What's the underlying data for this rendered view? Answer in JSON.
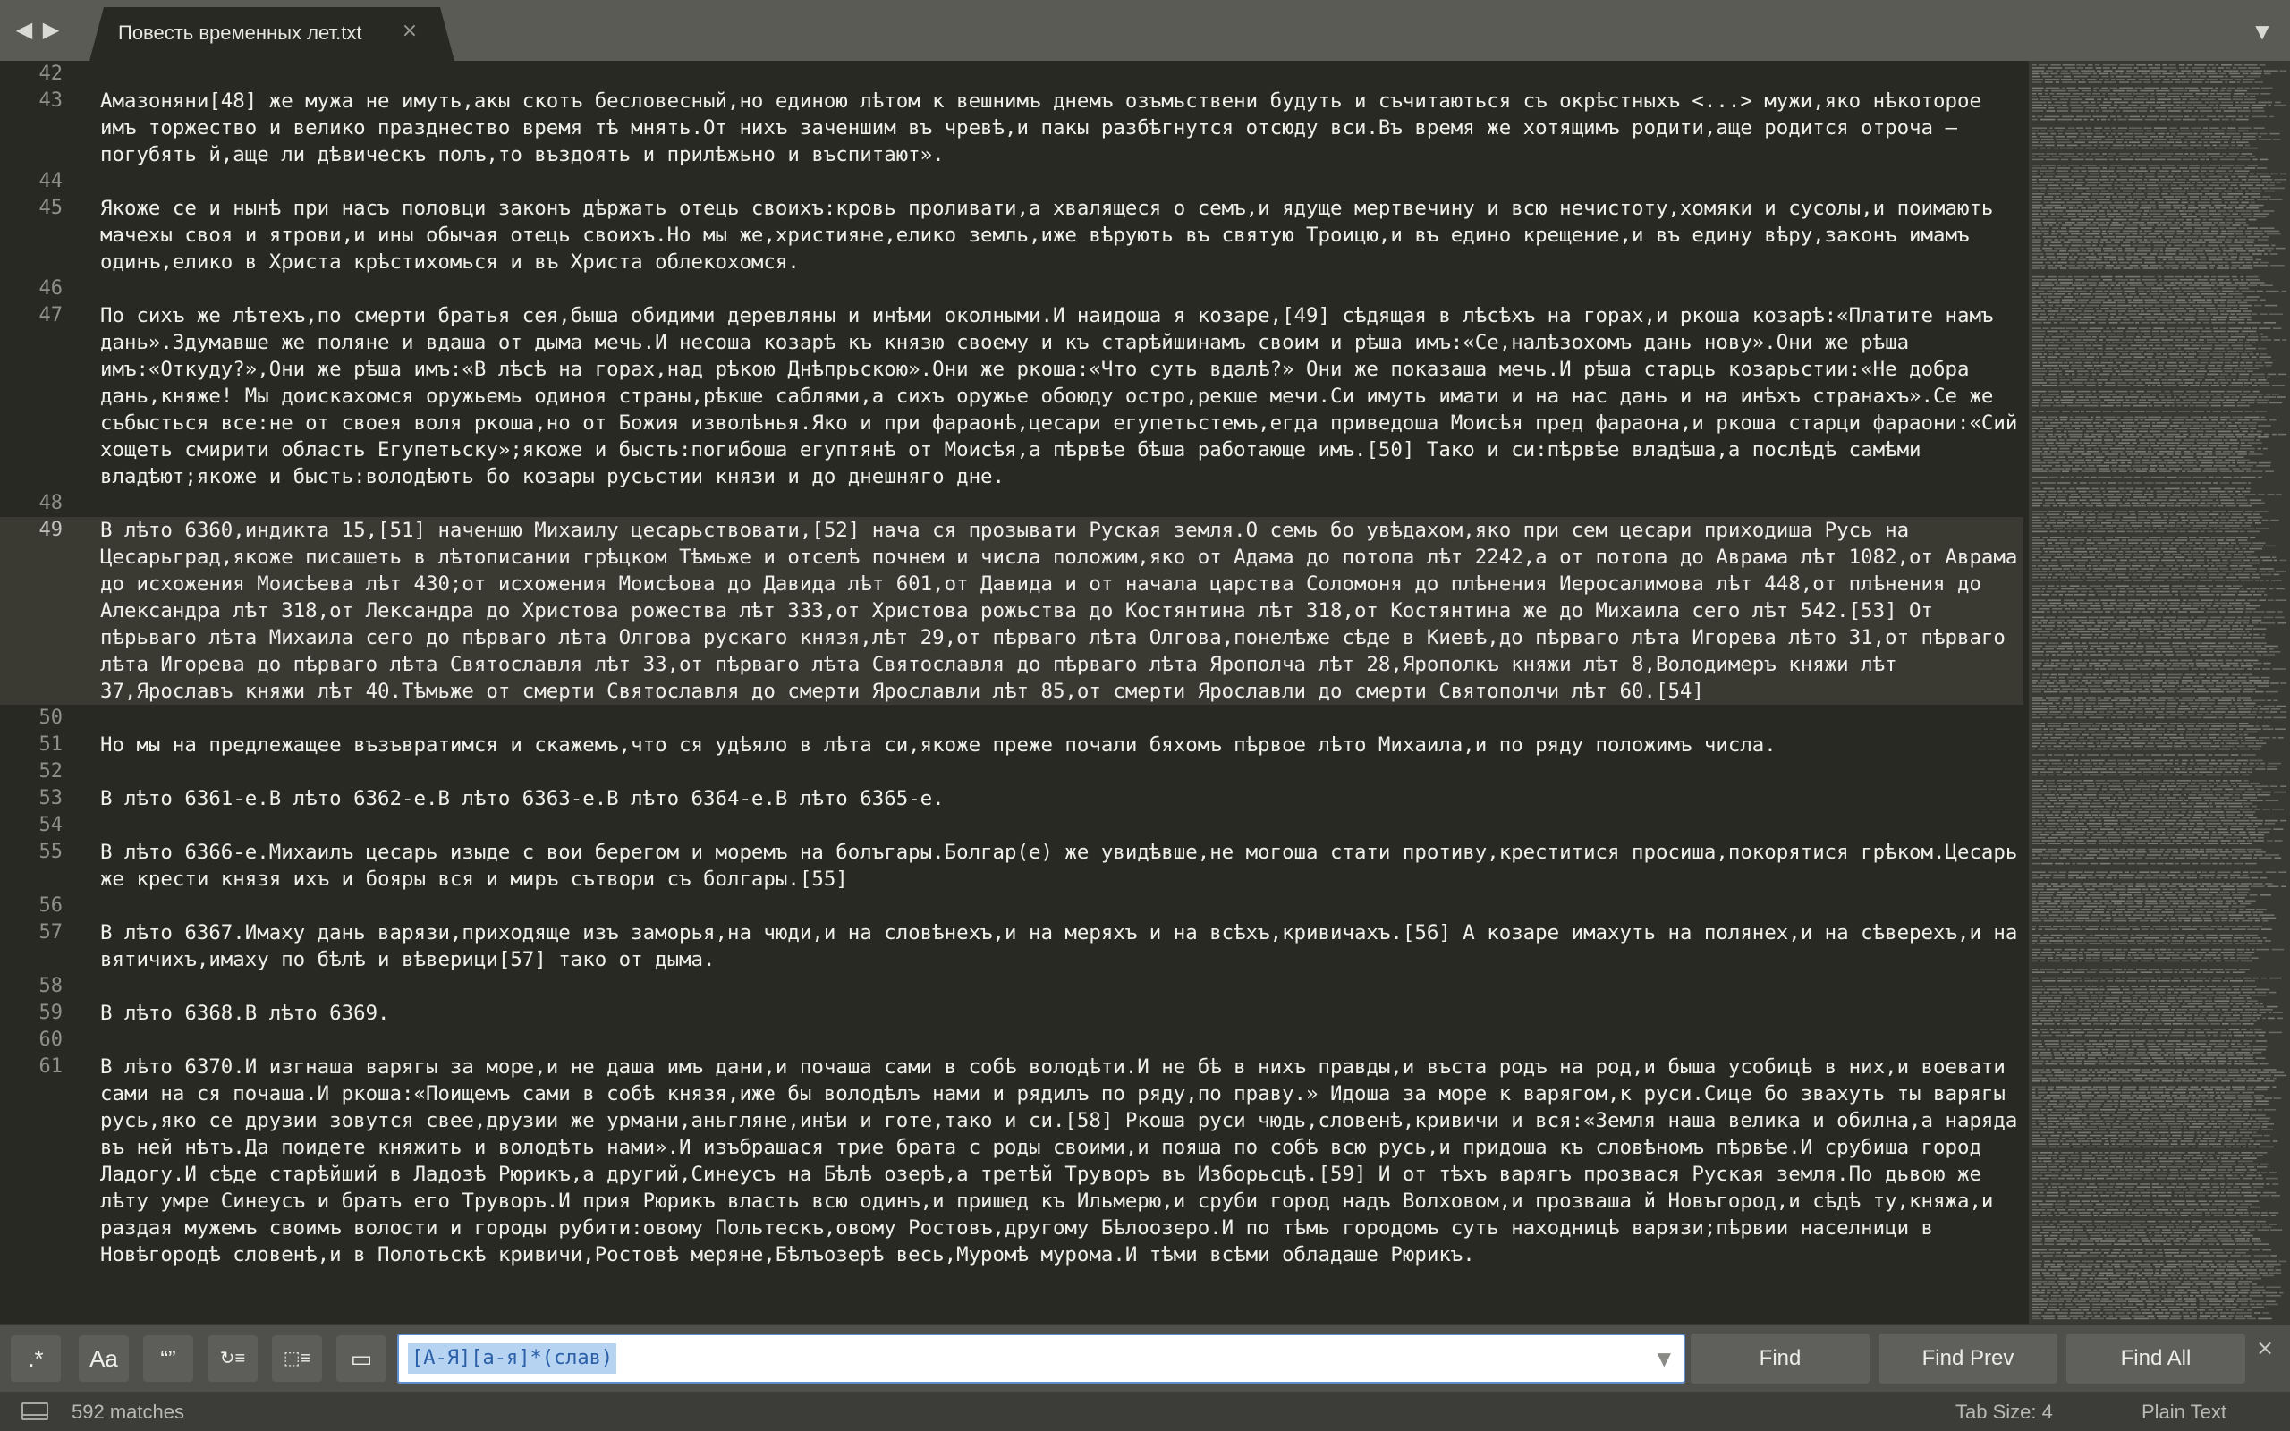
{
  "tab": {
    "title": "Повесть временных лет.txt",
    "close_glyph": "×",
    "nav_back": "◀",
    "nav_forward": "▶",
    "menu_glyph": "▼"
  },
  "editor": {
    "current_line": "49",
    "lines": [
      {
        "num": "42",
        "text": ""
      },
      {
        "num": "43",
        "text": "Амазоняни[48] же мужа не имуть,акы скотъ бесловесный,но единою лѣтом к вешнимъ днемъ озъмьствени будуть и съчитаються съ окрѣстныхъ <...> мужи,яко нѣкоторое имъ торжество и велико празднество время тѣ мнять.От нихъ заченшим въ чревѣ,и пакы разбѣгнутся отсюду вси.Въ время же хотящимъ родити,аще родится отроча — погубять й,аще ли дѣвическъ полъ,то въздоять и прилѣжьно и въспитают»."
      },
      {
        "num": "44",
        "text": ""
      },
      {
        "num": "45",
        "text": "Якоже се и нынѣ при насъ половци законъ дѣржать отець своихъ:кровь проливати,а хвалящеся о семъ,и ядуще мертвечину и всю нечистоту,хомяки и сусолы,и поимають мачехы своя и ятрови,и ины обычая отець своихъ.Но мы же,християне,елико земль,иже вѣрують въ святую Троицю,и въ едино крещение,и въ едину вѣру,законъ имамъ одинъ,елико в Христа крѣстихомься и въ Христа облекохомся."
      },
      {
        "num": "46",
        "text": ""
      },
      {
        "num": "47",
        "text": "По сихъ же лѣтехъ,по смерти братья сея,быша обидими деревляны и инѣми околными.И наидоша я козаре,[49] сѣдящая в лѣсѣхъ на горах,и ркоша козарѣ:«Платите намъ дань».Здумавше же поляне и вдаша от дыма мечь.И несоша козарѣ къ князю своему и къ старѣйшинамъ своим и рѣша имъ:«Се,налѣзохомъ дань нову».Они же рѣша имъ:«Откуду?»,Они же рѣша имъ:«В лѣсѣ на горах,над рѣкою Днѣпрьскою».Они же ркоша:«Что суть вдалѣ?» Они же показаша мечь.И рѣша старць козарьстии:«Не добра дань,княже! Мы доискахомся оружьемь одиноя страны,рѣкше саблями,а сихъ оружье обоюду остро,рекше мечи.Си имуть имати и на нас дань и на инѣхъ странахъ».Се же събысться все:не от своея воля ркоша,но от Божия изволѣнья.Яко и при фараонѣ,цесари егупетьстемъ,егда приведоша Моисѣя пред фараона,и ркоша старци фараони:«Сий хощеть смирити область Егупетьску»;якоже и бысть:погибоша егуптянѣ от Моисѣя,а пѣрвѣе бѣша работающе имъ.[50] Тако и си:пѣрвѣе владѣша,а послѣдѣ самѣми владѣют;якоже и бысть:володѣють бо козары русьстии князи и до днешняго дне."
      },
      {
        "num": "48",
        "text": ""
      },
      {
        "num": "49",
        "text": "В лѣто 6360,индикта 15,[51] наченшю Михаилу цесарьствовати,[52] нача ся прозывати Руская земля.О семь бо увѣдахом,яко при сем цесари приходиша Русь на Цесарьград,якоже писашеть в лѣтописании грѣцком Тѣмьже и отселѣ почнем и числа положим,яко от Адама до потопа лѣт 2242,а от потопа до Аврама лѣт 1082,от Аврама до исхожения Моисѣева лѣт 430;от исхожения Моисѣова до Давида лѣт 601,от Давида и от начала царства Соломоня до плѣнения Иеросалимова лѣт 448,от плѣнения до Александра лѣт 318,от Лександра до Христова рожества лѣт 333,от Христова рожьства до Костянтина лѣт 318,от Костянтина же до Михаила сего лѣт 542.[53] От пѣрьваго лѣта Михаила сего до пѣрваго лѣта Олгова рускаго князя,лѣт 29,от пѣрваго лѣта Олгова,понелѣже сѣде в Киевѣ,до пѣрваго лѣта Игорева лѣто 31,от пѣрваго лѣта Игорева до пѣрваго лѣта Святославля лѣт 33,от пѣрваго лѣта Святославля до пѣрваго лѣта Ярополча лѣт 28,Ярополкъ княжи лѣт 8,Володимеръ княжи лѣт 37,Ярославъ княжи лѣт 40.Тѣмьже от смерти Святославля до смерти Ярославли лѣт 85,от смерти Ярославли до смерти Святополчи лѣт 60.[54]"
      },
      {
        "num": "50",
        "text": ""
      },
      {
        "num": "51",
        "text": "Но мы на предлежащее възъвратимся и скажемъ,что ся удѣяло в лѣта си,якоже преже почали бяхомъ пѣрвое лѣто Михаила,и по ряду положимъ числа."
      },
      {
        "num": "52",
        "text": ""
      },
      {
        "num": "53",
        "text": "В лѣто 6361-е.В лѣто 6362-е.В лѣто 6363-е.В лѣто 6364-е.В лѣто 6365-е."
      },
      {
        "num": "54",
        "text": ""
      },
      {
        "num": "55",
        "text": "В лѣто 6366-е.Михаилъ цесарь изыде с вои берегом и моремъ на болъгары.Болгар(е) же увидѣвше,не могоша стати противу,креститися просиша,покорятися грѣком.Цесарь же крести князя ихъ и бояры вся и миръ сътвори съ болгары.[55]"
      },
      {
        "num": "56",
        "text": ""
      },
      {
        "num": "57",
        "text": "В лѣто 6367.Имаху дань варязи,приходяще изъ заморья,на чюди,и на словѣнехъ,и на меряхъ и на всѣхъ,кривичахъ.[56] А козаре имахуть на полянех,и на сѣверехъ,и на вятичихъ,имаху по бѣлѣ и вѣверици[57] тако от дыма."
      },
      {
        "num": "58",
        "text": ""
      },
      {
        "num": "59",
        "text": "В лѣто 6368.В лѣто 6369."
      },
      {
        "num": "60",
        "text": ""
      },
      {
        "num": "61",
        "text": "В лѣто 6370.И изгнаша варягы за море,и не даша имъ дани,и почаша сами в собѣ володѣти.И не бѣ в нихъ правды,и въста родъ на род,и быша усобицѣ в них,и воевати сами на ся почаша.И ркоша:«Поищемъ сами в собѣ князя,иже бы володѣлъ нами и рядилъ по ряду,по праву.» Идоша за море к варягом,к руси.Сице бо звахуть ты варягы русь,яко се друзии зовутся свее,друзии же урмани,аньгляне,инѣи и готе,тако и си.[58] Ркоша руси чюдь,словенѣ,кривичи и вся:«Земля наша велика и обилна,а наряда въ ней нѣтъ.Да поидете княжить и володѣть нами».И изъбрашася трие брата с роды своими,и пояша по собѣ всю русь,и придоша къ словѣномъ пѣрвѣе.И срубиша город Ладогу.И сѣде старѣйший в Ладозѣ Рюрикъ,а другий,Синеусъ на Бѣлѣ озерѣ,а третѣй Труворъ въ Изборьсцѣ.[59] И от тѣхъ варягъ прозвася Руская земля.По дьвою же лѣту умре Синеусъ и братъ его Труворъ.И прия Рюрикъ власть всю одинъ,и пришед къ Ильмерю,и сруби город надъ Волховом,и прозваша й Новъгород,и сѣдѣ ту,княжа,и раздая мужемъ своимъ волости и городы рубити:овому Польтескъ,овому Ростовъ,другому Бѣлоозеро.И по тѣмь городомъ суть находницѣ варязи;пѣрвии населници в Новѣгородѣ словенѣ,и в Полотьскѣ кривичи,Ростовѣ меряне,Бѣлъозерѣ весь,Муромѣ мурома.И тѣми всѣми обладаше Рюрикъ."
      }
    ]
  },
  "find": {
    "regex_label": ".*",
    "case_label": "Aa",
    "whole_word_label": "“”",
    "wrap_label": "↻≡",
    "in_selection_label": "⬚≡",
    "highlight_label": "▭",
    "query": "[А-Я][а-я]*(слав)",
    "history_glyph": "▼",
    "find_label": "Find",
    "find_prev_label": "Find Prev",
    "find_all_label": "Find All",
    "close_glyph": "×"
  },
  "status": {
    "matches": "592 matches",
    "tab_size": "Tab Size: 4",
    "syntax": "Plain Text"
  },
  "colors": {
    "background": "#282923",
    "text": "#f0f0ea",
    "gutter_text": "#8f908a",
    "current_line": "#3a3a33",
    "find_selection": "#b6d3f2"
  }
}
